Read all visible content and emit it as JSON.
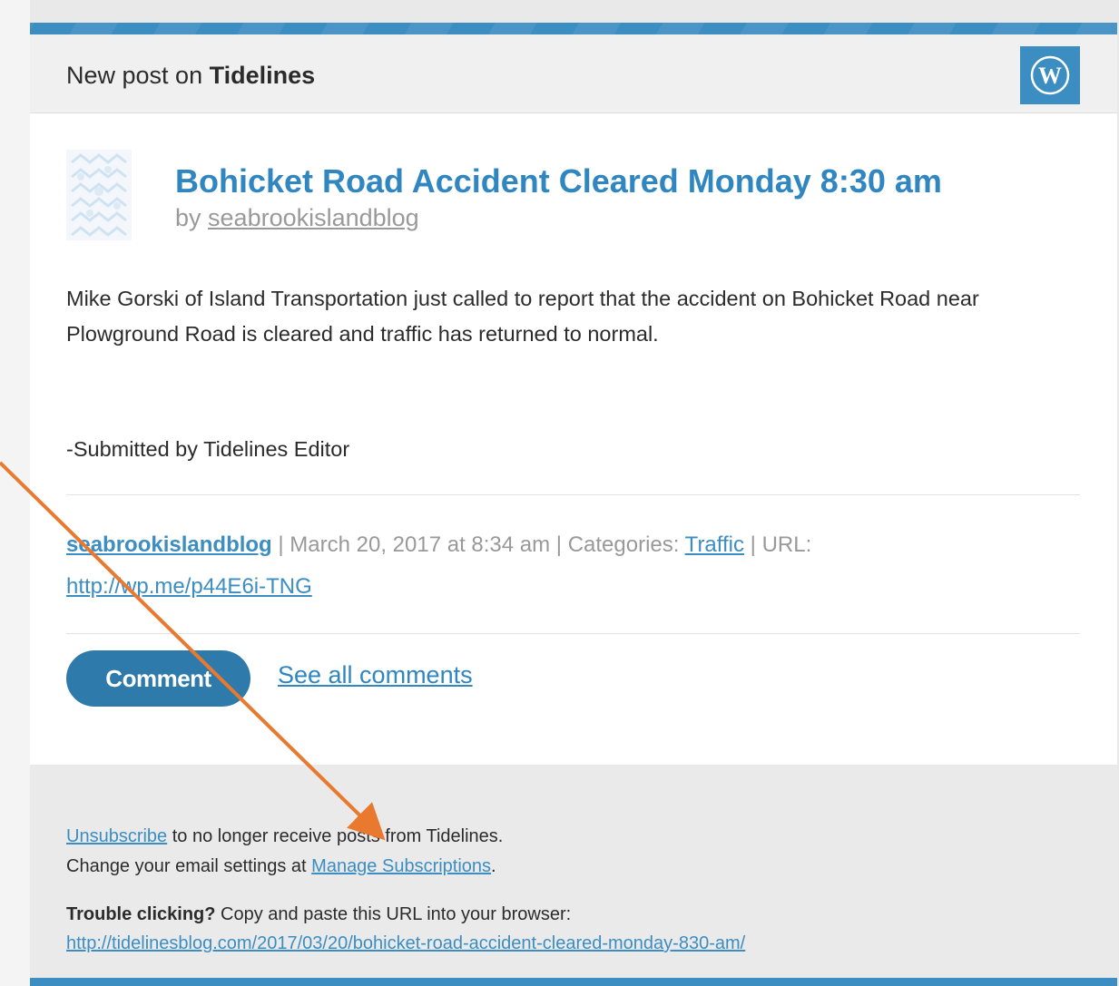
{
  "header": {
    "prefix": "New post on ",
    "site_name": "Tidelines"
  },
  "post": {
    "title": "Bohicket Road Accident Cleared Monday 8:30 am",
    "by_prefix": "by ",
    "author": "seabrookislandblog",
    "body": "Mike Gorski of Island Transportation just called to report that the accident on Bohicket Road near Plowground Road is cleared and traffic has returned to normal.",
    "submitted": "-Submitted by Tidelines Editor"
  },
  "meta": {
    "author": "seabrookislandblog",
    "date_text": " | March 20, 2017 at 8:34 am | Categories: ",
    "category": "Traffic",
    "url_label": " | URL: ",
    "short_url": "http://wp.me/p44E6i-TNG"
  },
  "actions": {
    "comment_label": "Comment",
    "see_all_label": "See all comments"
  },
  "footer": {
    "unsubscribe_link": "Unsubscribe",
    "unsubscribe_text": " to no longer receive posts from Tidelines.",
    "change_text": "Change your email settings at ",
    "manage_link": "Manage Subscriptions",
    "period": ".",
    "trouble_bold": "Trouble clicking?",
    "trouble_text": " Copy and paste this URL into your browser:",
    "full_url": "http://tidelinesblog.com/2017/03/20/bohicket-road-accident-cleared-monday-830-am/"
  },
  "icons": {
    "wordpress": "wordpress-logo-icon",
    "blavatar": "site-blavatar-icon",
    "annotation": "annotation-arrow"
  },
  "colors": {
    "accent": "#3c8dc1",
    "title": "#2f86c0",
    "button": "#2e7bab",
    "arrow": "#e8792e"
  }
}
